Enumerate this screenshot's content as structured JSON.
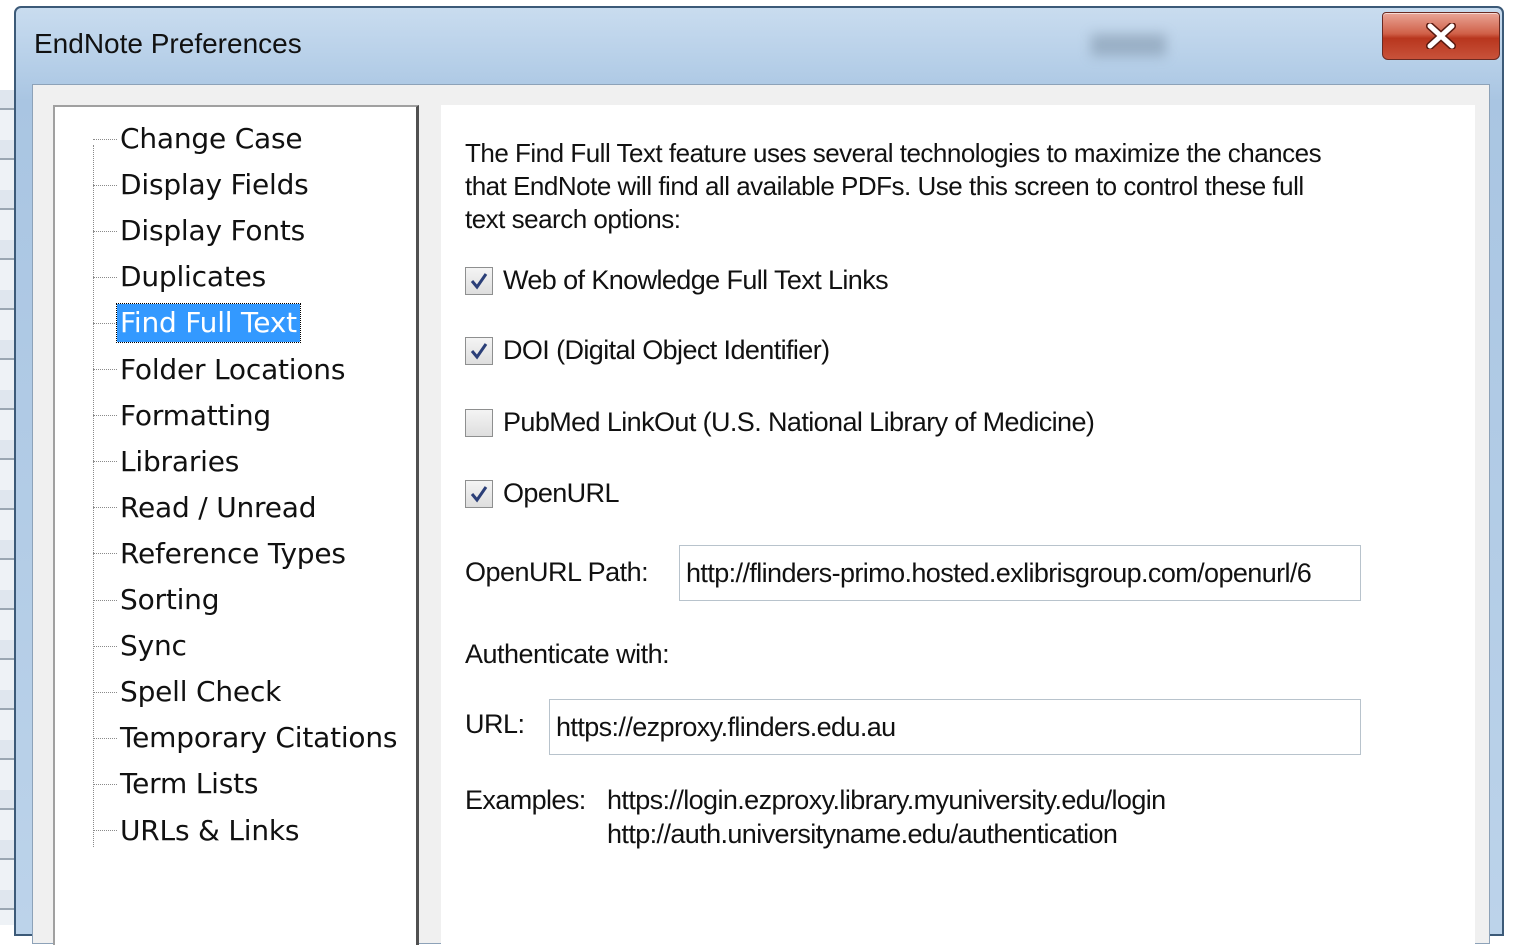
{
  "window": {
    "title": "EndNote Preferences",
    "close_label": "X"
  },
  "sidebar": {
    "items": [
      {
        "label": "Change Case",
        "selected": false
      },
      {
        "label": "Display Fields",
        "selected": false
      },
      {
        "label": "Display Fonts",
        "selected": false
      },
      {
        "label": "Duplicates",
        "selected": false
      },
      {
        "label": "Find Full Text",
        "selected": true
      },
      {
        "label": "Folder Locations",
        "selected": false
      },
      {
        "label": "Formatting",
        "selected": false
      },
      {
        "label": "Libraries",
        "selected": false
      },
      {
        "label": "Read / Unread",
        "selected": false
      },
      {
        "label": "Reference Types",
        "selected": false
      },
      {
        "label": "Sorting",
        "selected": false
      },
      {
        "label": "Sync",
        "selected": false
      },
      {
        "label": "Spell Check",
        "selected": false
      },
      {
        "label": "Temporary Citations",
        "selected": false
      },
      {
        "label": "Term Lists",
        "selected": false
      },
      {
        "label": "URLs & Links",
        "selected": false
      }
    ]
  },
  "main": {
    "description": "The Find Full Text feature uses several technologies to maximize the chances that EndNote will find all available PDFs. Use this screen to control these full text search options:",
    "options": [
      {
        "label": "Web of Knowledge Full Text Links",
        "checked": true
      },
      {
        "label": "DOI (Digital Object Identifier)",
        "checked": true
      },
      {
        "label": "PubMed LinkOut (U.S. National Library of Medicine)",
        "checked": false
      },
      {
        "label": "OpenURL",
        "checked": true
      }
    ],
    "openurl_path_label": "OpenURL Path:",
    "openurl_path_value": "http://flinders-primo.hosted.exlibrisgroup.com/openurl/6",
    "authenticate_label": "Authenticate with:",
    "url_label": "URL:",
    "url_value": "https://ezproxy.flinders.edu.au",
    "examples_label": "Examples:",
    "examples": [
      "https://login.ezproxy.library.myuniversity.edu/login",
      "http://auth.universityname.edu/authentication"
    ]
  }
}
